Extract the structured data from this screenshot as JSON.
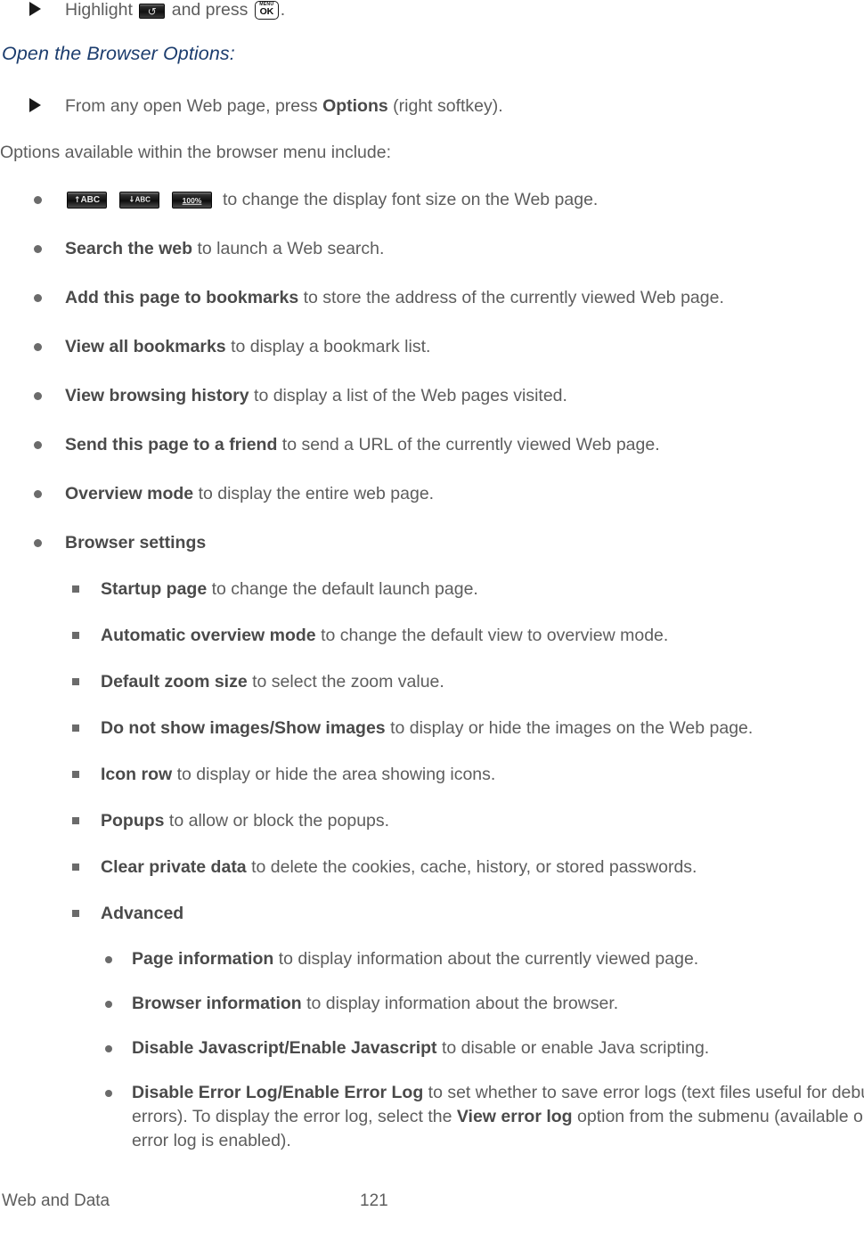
{
  "page": {
    "intro_step": {
      "marker": "triangle-marker",
      "prefix": "Highlight",
      "icon1": "back-softkey-icon",
      "middle": "and press",
      "icon2": "menu-ok-key-icon",
      "suffix": "."
    },
    "heading": "Open the Browser Options:",
    "open_step": {
      "marker": "triangle-marker",
      "prefix": "From any open Web page, press",
      "bold": "Options",
      "suffix": "(right softkey)."
    },
    "lead_in": "Options available within the browser menu include:",
    "font_size_item": {
      "icons": [
        {
          "name": "font-size-increase-icon",
          "arrow": "↑",
          "label": "ABC"
        },
        {
          "name": "font-size-decrease-icon",
          "arrow": "↓",
          "label": "ABC"
        },
        {
          "name": "font-size-reset-icon",
          "arrow": "",
          "label": "100%"
        }
      ],
      "text": "to change the display font size on the Web page."
    },
    "options": [
      {
        "bold": "Search the web",
        "text": "to launch a Web search."
      },
      {
        "bold": "Add this page to bookmarks",
        "text": "to store the address of the currently viewed Web page."
      },
      {
        "bold": "View all bookmarks",
        "text": "to display a bookmark list."
      },
      {
        "bold": "View browsing history",
        "text": "to display a list of the Web pages visited."
      },
      {
        "bold": "Send this page to a friend",
        "text": "to send a URL of the currently viewed Web page."
      },
      {
        "bold": "Overview mode",
        "text": "to display the entire web page."
      },
      {
        "bold": "Browser settings",
        "text": ""
      }
    ],
    "browser_settings": [
      {
        "bold": "Startup page",
        "text": "to change the default launch page."
      },
      {
        "bold": "Automatic overview mode",
        "text": "to change the default view to overview mode."
      },
      {
        "bold": "Default zoom size",
        "text": "to select the zoom value."
      },
      {
        "bold": "Do not show images/Show images",
        "text": "to display or hide the images on the Web page."
      },
      {
        "bold": "Icon row",
        "text": "to display or hide the area showing icons."
      },
      {
        "bold": "Popups",
        "text": "to allow or block the popups."
      },
      {
        "bold": "Clear private data",
        "text": "to delete the cookies, cache, history, or stored passwords."
      },
      {
        "bold": "Advanced",
        "text": ""
      }
    ],
    "advanced": [
      {
        "bold": "Page information",
        "text": "to display information about the currently viewed page."
      },
      {
        "bold": "Browser information",
        "text": "to display information about the browser."
      },
      {
        "bold": "Disable Javascript/Enable Javascript",
        "text": "to disable or enable Java scripting."
      }
    ],
    "error_log_item": {
      "bold1": "Disable Error Log/Enable Error Log",
      "text1": "to set whether to save error logs (text files useful for debugging browser errors). To display the error log, select the",
      "bold2": "View error log",
      "text2": "option from the submenu (available only when the error log is enabled)."
    },
    "footer": {
      "section": "Web and Data",
      "page_number": "121"
    }
  }
}
